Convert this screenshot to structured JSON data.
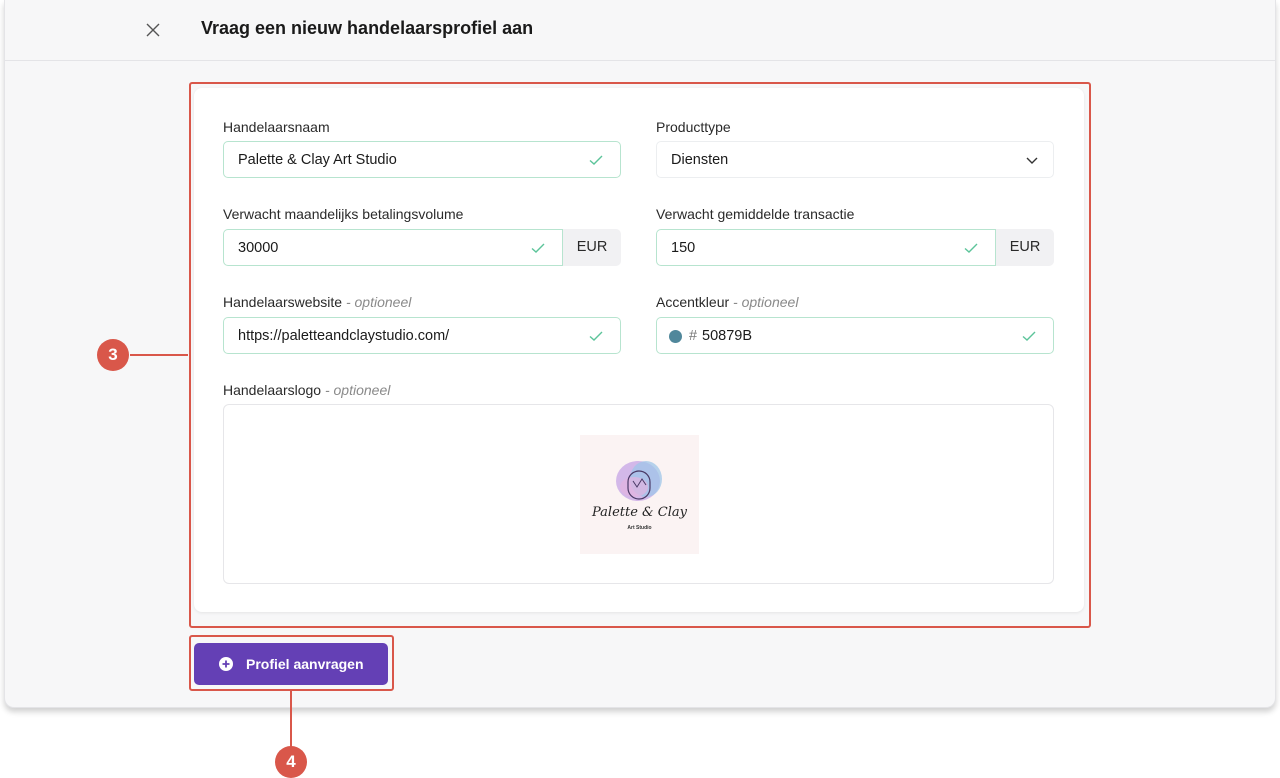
{
  "header": {
    "title": "Vraag een nieuw handelaarsprofiel aan",
    "close_icon": "close-icon"
  },
  "form": {
    "merchant_name": {
      "label": "Handelaarsnaam",
      "value": "Palette & Clay Art Studio"
    },
    "product_type": {
      "label": "Producttype",
      "value": "Diensten"
    },
    "monthly_volume": {
      "label": "Verwacht maandelijks betalingsvolume",
      "value": "30000",
      "currency": "EUR"
    },
    "avg_transaction": {
      "label": "Verwacht gemiddelde transactie",
      "value": "150",
      "currency": "EUR"
    },
    "website": {
      "label": "Handelaarswebsite",
      "optional": "- optioneel",
      "value": "https://paletteandclaystudio.com/"
    },
    "accent_color": {
      "label": "Accentkleur",
      "optional": "- optioneel",
      "hash": "#",
      "value": "50879B",
      "color": "#50879B"
    },
    "logo": {
      "label": "Handelaarslogo",
      "optional": "- optioneel",
      "logo_text": "Palette & Clay",
      "logo_subtext": "Art Studio"
    }
  },
  "actions": {
    "submit_label": "Profiel aanvragen"
  },
  "annotations": {
    "form_marker": "3",
    "button_marker": "4",
    "highlight_color": "#d9574a"
  }
}
